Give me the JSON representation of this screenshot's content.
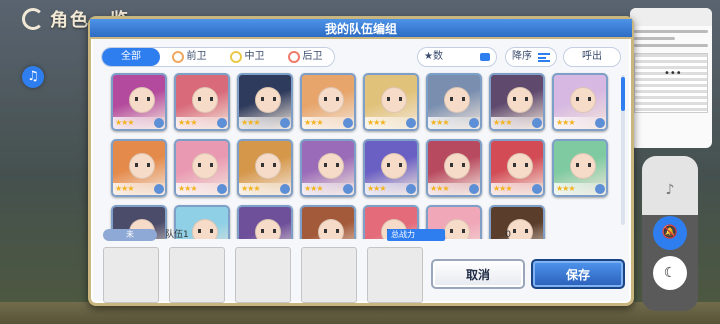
{
  "background": {
    "title": "角色一览"
  },
  "dialog": {
    "title": "我的队伍编组",
    "filters": [
      {
        "label": "全部"
      },
      {
        "label": "前卫"
      },
      {
        "label": "中卫"
      },
      {
        "label": "后卫"
      }
    ],
    "sort_key": "★数",
    "order_label": "降序",
    "callout_label": "呼出",
    "characters": [
      {
        "hair": "#b44a9d",
        "stars": "★★★"
      },
      {
        "hair": "#d86a7a",
        "stars": "★★★"
      },
      {
        "hair": "#2f3b5d",
        "stars": "★★★"
      },
      {
        "hair": "#e7a56b",
        "stars": "★★★"
      },
      {
        "hair": "#e1c27a",
        "stars": "★★★"
      },
      {
        "hair": "#7a8fb0",
        "stars": "★★★"
      },
      {
        "hair": "#5f4a6e",
        "stars": "★★★"
      },
      {
        "hair": "#d7b8e3",
        "stars": "★★★"
      },
      {
        "hair": "#e48a4a",
        "stars": "★★★"
      },
      {
        "hair": "#e99ab2",
        "stars": "★★★"
      },
      {
        "hair": "#d5974a",
        "stars": "★★★"
      },
      {
        "hair": "#9a6bb8",
        "stars": "★★★"
      },
      {
        "hair": "#6a5fc3",
        "stars": "★★★"
      },
      {
        "hair": "#b84a5f",
        "stars": "★★★"
      },
      {
        "hair": "#d24b55",
        "stars": "★★★"
      },
      {
        "hair": "#7fcaa1",
        "stars": "★★★"
      },
      {
        "hair": "#4b4b6a",
        "stars": ""
      },
      {
        "hair": "#8fd0e6",
        "stars": ""
      },
      {
        "hair": "#6d4f9a",
        "stars": ""
      },
      {
        "hair": "#a35a3a",
        "stars": ""
      },
      {
        "hair": "#e36b7a",
        "stars": ""
      },
      {
        "hair": "#f0a8b8",
        "stars": ""
      },
      {
        "hair": "#5a3d2b",
        "stars": ""
      }
    ],
    "team": {
      "badge": "未",
      "name": "队伍1",
      "power_label": "总战力",
      "power_value": "0"
    },
    "buttons": {
      "cancel": "取消",
      "save": "保存"
    }
  }
}
